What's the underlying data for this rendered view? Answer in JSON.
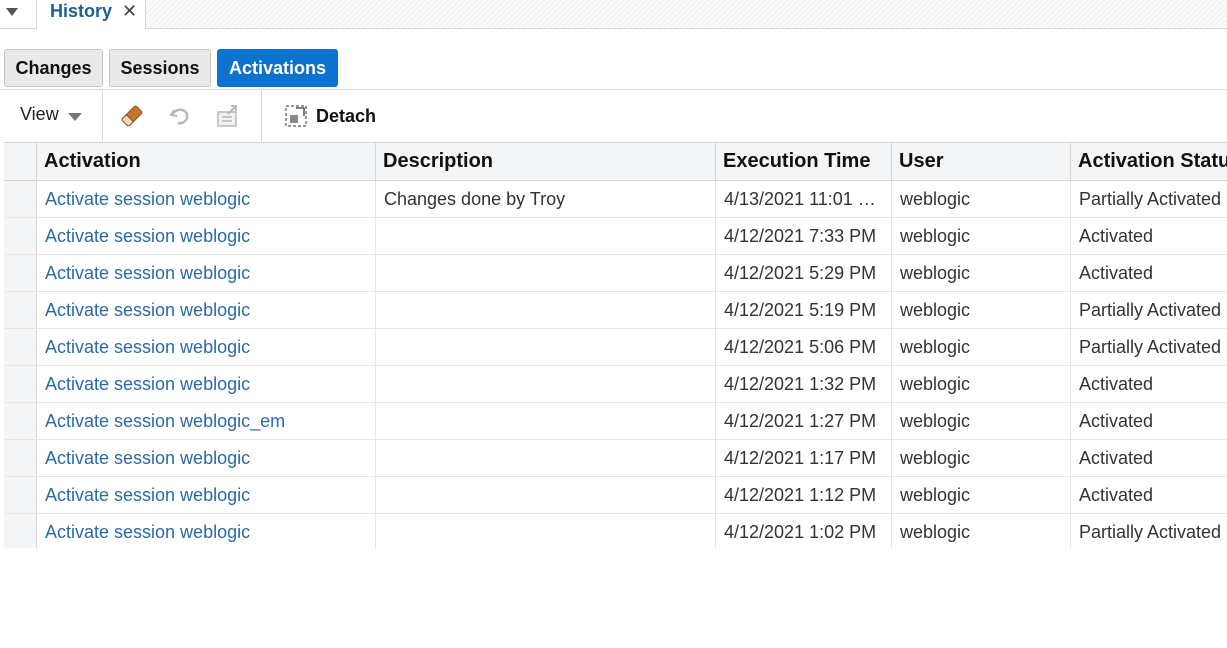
{
  "tabs": {
    "active_label": "History",
    "close_glyph": "✕"
  },
  "segments": [
    {
      "label": "Changes",
      "active": false
    },
    {
      "label": "Sessions",
      "active": false
    },
    {
      "label": "Activations",
      "active": true
    }
  ],
  "toolbar": {
    "view_label": "View",
    "icons": [
      "eraser-icon",
      "undo-icon",
      "export-icon"
    ],
    "detach_label": "Detach"
  },
  "table": {
    "columns": [
      "Activation",
      "Description",
      "Execution Time",
      "User",
      "Activation Status"
    ],
    "rows": [
      {
        "activation": "Activate session weblogic",
        "description": "Changes done by Troy",
        "time": "4/13/2021 11:01 …",
        "user": "weblogic",
        "status": "Partially Activated"
      },
      {
        "activation": "Activate session weblogic",
        "description": "",
        "time": "4/12/2021 7:33 PM",
        "user": "weblogic",
        "status": "Activated"
      },
      {
        "activation": "Activate session weblogic",
        "description": "",
        "time": "4/12/2021 5:29 PM",
        "user": "weblogic",
        "status": "Activated"
      },
      {
        "activation": "Activate session weblogic",
        "description": "",
        "time": "4/12/2021 5:19 PM",
        "user": "weblogic",
        "status": "Partially Activated"
      },
      {
        "activation": "Activate session weblogic",
        "description": "",
        "time": "4/12/2021 5:06 PM",
        "user": "weblogic",
        "status": "Partially Activated"
      },
      {
        "activation": "Activate session weblogic",
        "description": "",
        "time": "4/12/2021 1:32 PM",
        "user": "weblogic",
        "status": "Activated"
      },
      {
        "activation": "Activate session weblogic_em",
        "description": "",
        "time": "4/12/2021 1:27 PM",
        "user": "weblogic",
        "status": "Activated"
      },
      {
        "activation": "Activate session weblogic",
        "description": "",
        "time": "4/12/2021 1:17 PM",
        "user": "weblogic",
        "status": "Activated"
      },
      {
        "activation": "Activate session weblogic",
        "description": "",
        "time": "4/12/2021 1:12 PM",
        "user": "weblogic",
        "status": "Activated"
      },
      {
        "activation": "Activate session weblogic",
        "description": "",
        "time": "4/12/2021 1:02 PM",
        "user": "weblogic",
        "status": "Partially Activated"
      }
    ]
  },
  "colors": {
    "accent": "#0c72d0",
    "link": "#2a6aa8",
    "tab_title": "#1a5e9a"
  }
}
